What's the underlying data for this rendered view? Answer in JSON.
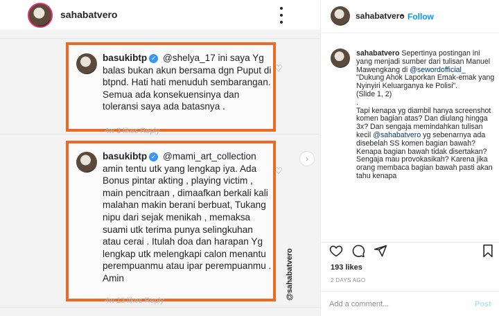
{
  "post": {
    "username": "sahabatvero",
    "card1": {
      "username": "basukibtp",
      "text": "@shelya_17 ini saya Yg balas bukan akun bersama dgn Puput di btpnd. Hati hati menuduh sembarangan. Semua ada konsekuensinya dan toleransi saya ada batasnya .",
      "faint": "4w   3 likes   Reply"
    },
    "card2": {
      "username": "basukibtp",
      "text": "@mami_art_collection amin tentu utk yang lengkap iya. Ada Bonus pintar akting , playing victim , main pencitraan , dimaafkan berkali kali malahan makin berani berbuat, Tukang nipu dari sejak menikah , memaksa suami utk terima punya selingkuhan atau cerai . Itulah doa dan harapan Yg lengkap utk melengkapi calon menantu perempuanmu atau ipar perempuanmu . Amin",
      "faint": "4w   13 likes   Reply"
    },
    "watermark": "@sahabatvero",
    "next_arrow": "›",
    "verified_mark": "✓"
  },
  "sidebar": {
    "username": "sahabatvero",
    "separator": "•",
    "follow_label": "Follow",
    "caption": {
      "username": "sahabatvero",
      "intro": "Sepertinya postingan ini yang menjadi sumber dari tulisan Manuel Mawengkang di",
      "mention1": "@sewordofficial_",
      "quote": "\"Dukung Ahok Laporkan Emak-emak yang Nyinyiri Keluarganya ke Polisi\".",
      "slide": "(Slide 1, 2)",
      "dot": ".",
      "para2": "Tapi kenapa yg diambil hanya screenshot komen bagian atas? Dan diulang hingga 3x? Dan sengaja memindahkan tulisan kecil",
      "mention2": "@sahabatvero",
      "para2b": "yg sebenarnya ada disebelah SS komen bagian bawah? Kenapa bagian bawah tidak disertakan?",
      "para3": "Sengaja mau provokasikah? Karena jika orang membaca bagian bawah pasti akan tahu kenapa"
    },
    "likes": "193 likes",
    "time": "2 DAYS AGO",
    "comment_placeholder": "Add a comment...",
    "post_label": "Post"
  }
}
